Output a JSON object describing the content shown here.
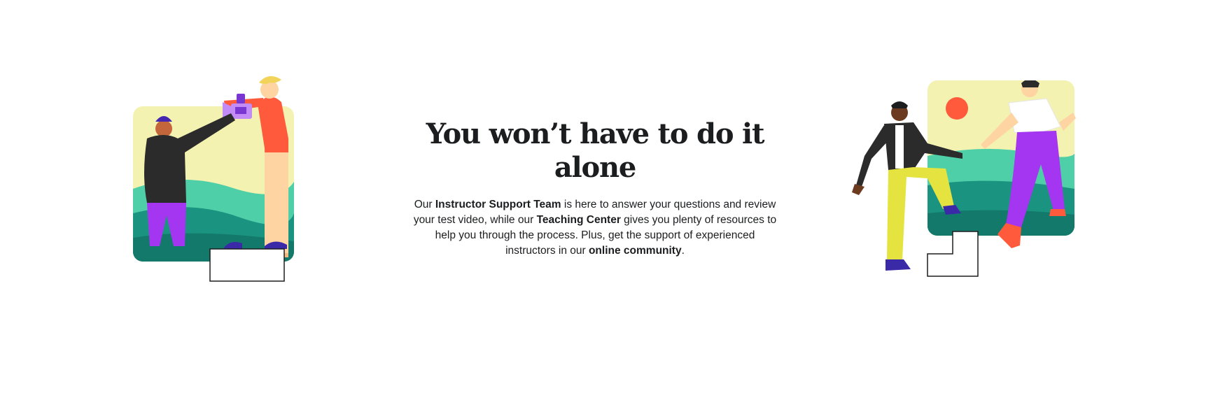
{
  "section": {
    "heading": "You won’t have to do it alone",
    "paragraph": {
      "t1": "Our ",
      "b1": "Instructor Support Team",
      "t2": " is here to answer your questions and review your test video, while our ",
      "b2": "Teaching Center",
      "t3": " gives you plenty of resources to help you through the process. Plus, get the support of experienced instructors in our ",
      "b3": "online community",
      "t4": "."
    }
  },
  "illustrations": {
    "left": "videographer-illustration",
    "right": "stairs-helping-hand-illustration"
  },
  "colors": {
    "text": "#1c1d1f",
    "sky": "#f4f2b0",
    "teal": "#4fcfa8",
    "dark_teal": "#1a9480",
    "purple": "#a435f0",
    "orange": "#ff5a3c",
    "yellow_green": "#e4e33f",
    "navy": "#3a2aa8"
  }
}
